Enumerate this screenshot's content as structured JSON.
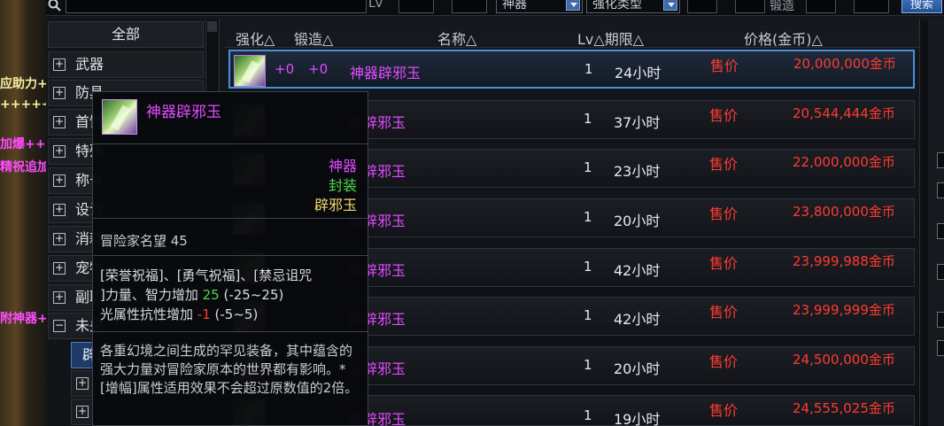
{
  "topbar": {
    "lv_label": "Lv",
    "rarity_select": "神器",
    "enhance_type_select": "强化类型",
    "forge_label": "锻造",
    "search_button": "搜索"
  },
  "world": {
    "floaters": [
      "应助力+",
      "+++++",
      "加爆+++",
      "精祝追加",
      "附神器+"
    ]
  },
  "categories": {
    "all": "全部",
    "items": [
      "武器",
      "防具",
      "首饰",
      "特殊",
      "称号",
      "设计",
      "消耗",
      "宠物",
      "副职",
      "未央"
    ],
    "active_sub": "辟邪",
    "sub_items": [
      "",
      ""
    ],
    "collapsed_symbol": "+",
    "expanded_symbol": "−"
  },
  "header": {
    "enhance": "强化△",
    "forge": "锻造△",
    "name": "名称△",
    "lv_limit": "Lv△期限△",
    "price": "价格(金币)△"
  },
  "rows": [
    {
      "plus1": "+0",
      "plus2": "+0",
      "name": "神器辟邪玉",
      "lv": "1",
      "limit": "24小时",
      "sale": "售价",
      "price": "20,000,000金币"
    },
    {
      "plus1": "",
      "plus2": "",
      "name": "器辟邪玉",
      "lv": "1",
      "limit": "37小时",
      "sale": "售价",
      "price": "20,544,444金币"
    },
    {
      "plus1": "",
      "plus2": "",
      "name": "器辟邪玉",
      "lv": "1",
      "limit": "23小时",
      "sale": "售价",
      "price": "22,000,000金币"
    },
    {
      "plus1": "",
      "plus2": "",
      "name": "器辟邪玉",
      "lv": "1",
      "limit": "20小时",
      "sale": "售价",
      "price": "23,800,000金币"
    },
    {
      "plus1": "",
      "plus2": "",
      "name": "器辟邪玉",
      "lv": "1",
      "limit": "42小时",
      "sale": "售价",
      "price": "23,999,988金币"
    },
    {
      "plus1": "",
      "plus2": "",
      "name": "器辟邪玉",
      "lv": "1",
      "limit": "42小时",
      "sale": "售价",
      "price": "23,999,999金币"
    },
    {
      "plus1": "",
      "plus2": "",
      "name": "器辟邪玉",
      "lv": "1",
      "limit": "20小时",
      "sale": "售价",
      "price": "24,500,000金币"
    },
    {
      "plus1": "",
      "plus2": "",
      "name": "器辟邪玉",
      "lv": "1",
      "limit": "19小时",
      "sale": "售价",
      "price": "24,555,025金币"
    }
  ],
  "tooltip": {
    "title": "神器辟邪玉",
    "rarity": "神器",
    "seal": "封装",
    "type": "辟邪玉",
    "fame": "冒险家名望 45",
    "stat1_line1": "[荣誉祝福]、[勇气祝福]、[禁忌诅咒",
    "stat1_line2_prefix": "]力量、智力增加 ",
    "stat1_value": "25",
    "stat1_range": " (-25~25)",
    "stat2_prefix": "光属性抗性增加 ",
    "stat2_value": "-1",
    "stat2_range": " (-5~5)",
    "description": "各重幻境之间生成的罕见装备，其中蕴含的强大力量对冒险家原本的世界都有影响。*[增幅]属性适用效果不会超过原数值的2倍。"
  },
  "colors": {
    "epic_purple": "#e04cff",
    "price_red": "#ff3b30",
    "seal_green": "#4cd94c",
    "type_gold": "#f2d86b",
    "selection_blue": "#4b8fd9"
  }
}
